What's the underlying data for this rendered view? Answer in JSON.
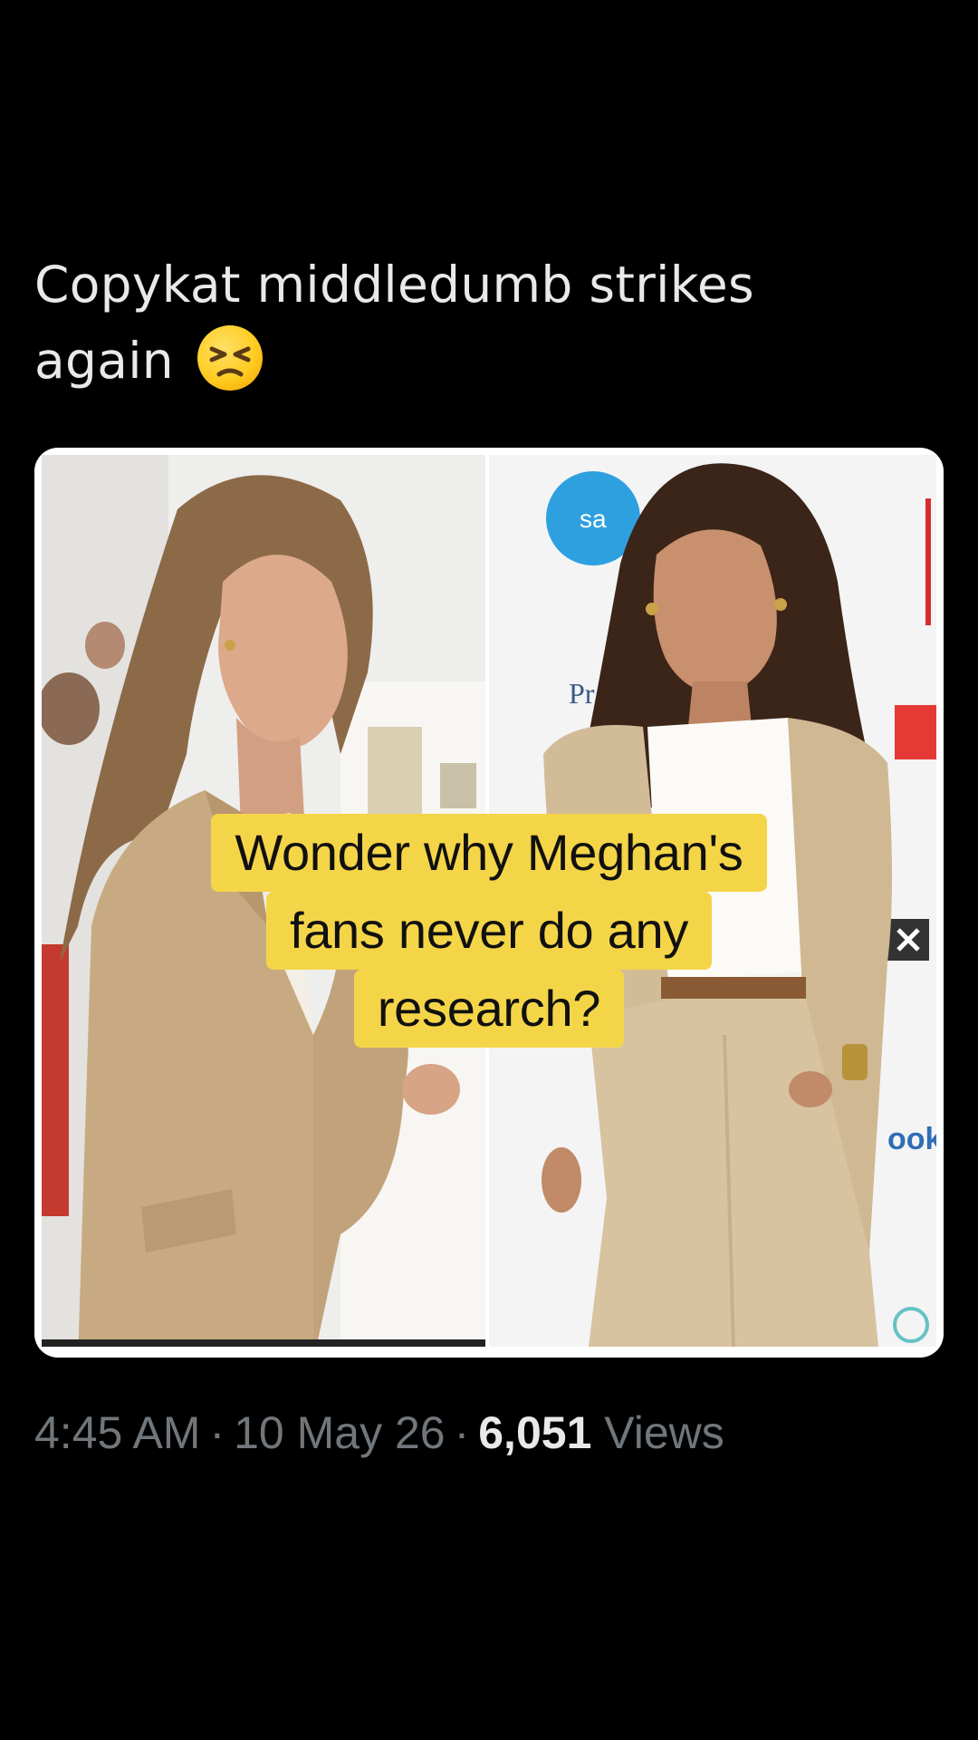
{
  "tweet": {
    "text_line1": "Copykat middledumb strikes",
    "text_line2": "again",
    "emoji_icon": "persevering-face-emoji"
  },
  "media": {
    "caption_lines": [
      "Wonder why Meghan's",
      "fans never do any",
      "research?"
    ],
    "right_photo_signage": {
      "logo_text": "sa",
      "sponsor_text": "Pr",
      "side_text": "ook"
    }
  },
  "meta": {
    "time": "4:45 AM",
    "separator": "·",
    "date": "10 May 26",
    "views_count": "6,051",
    "views_label": "Views"
  },
  "colors": {
    "background": "#000000",
    "text_primary": "#e7e9ea",
    "text_secondary": "#71767b",
    "caption_highlight": "#f5d548"
  }
}
